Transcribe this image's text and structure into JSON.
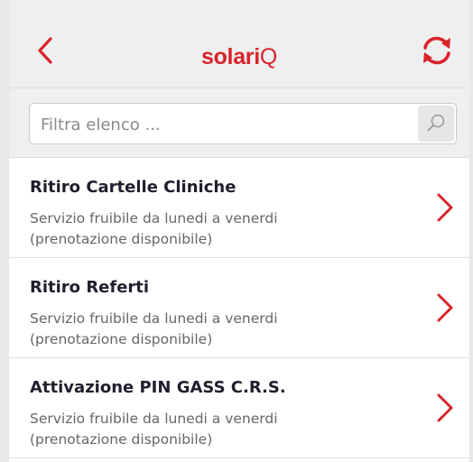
{
  "header": {
    "brand_part1": "solari",
    "brand_part2": "Q",
    "back_icon": "chevron-left-icon",
    "refresh_icon": "refresh-icon",
    "accent_color": "#d8232a"
  },
  "search": {
    "placeholder": "Filtra elenco ...",
    "value": "",
    "icon": "search-icon"
  },
  "services": [
    {
      "title": "Ritiro Cartelle Cliniche",
      "line1": "Servizio fruibile da lunedi a venerdi",
      "line2": "(prenotazione disponibile)"
    },
    {
      "title": "Ritiro Referti",
      "line1": "Servizio fruibile da lunedi a venerdi",
      "line2": "(prenotazione disponibile)"
    },
    {
      "title": "Attivazione PIN GASS C.R.S.",
      "line1": "Servizio fruibile da lunedi a venerdi",
      "line2": "(prenotazione disponibile)"
    }
  ]
}
